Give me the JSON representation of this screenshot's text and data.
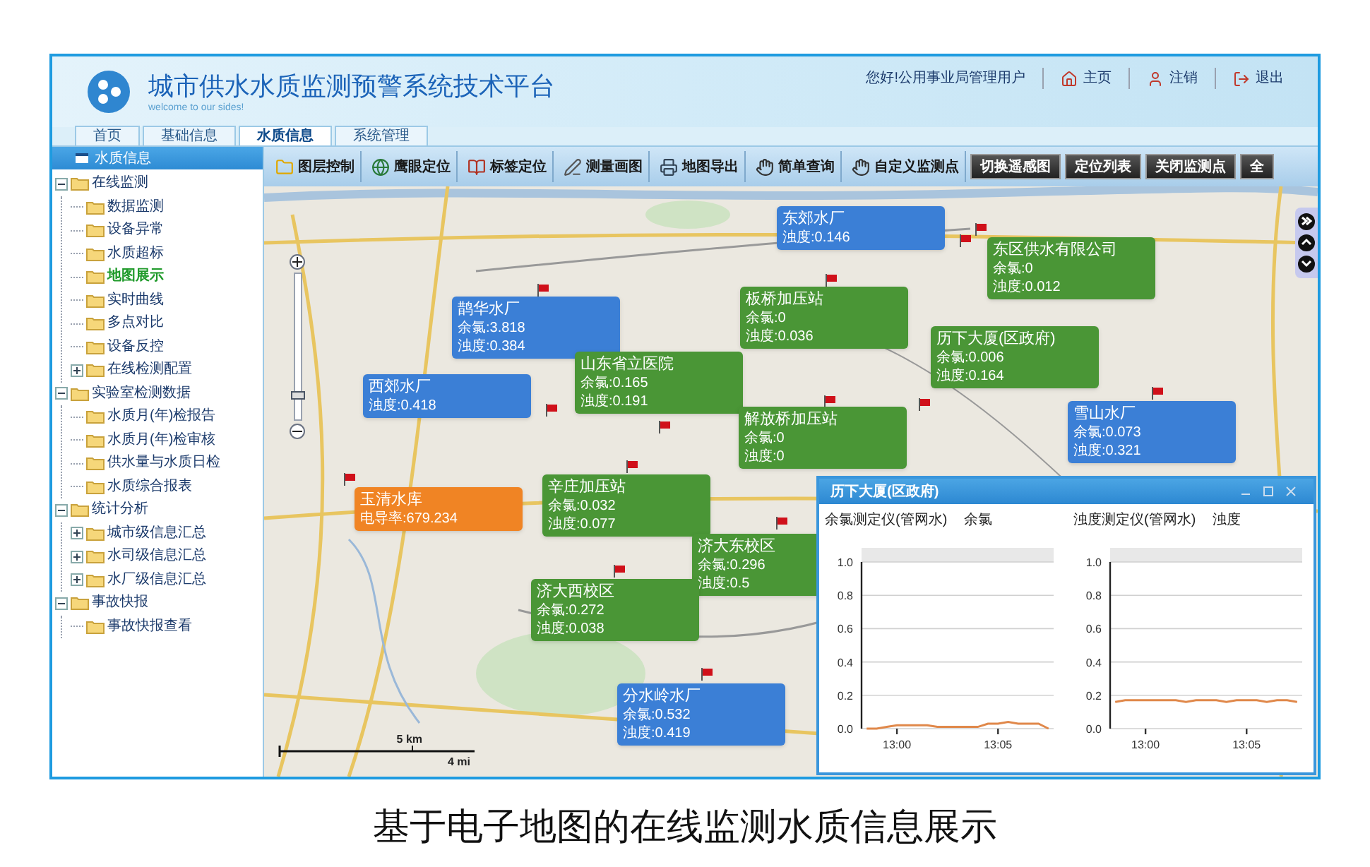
{
  "header": {
    "title": "城市供水水质监测预警系统技术平台",
    "subtitle": "welcome to our sides!",
    "greeting": "您好!公用事业局管理用户",
    "links": [
      {
        "kind": "home",
        "label": "主页"
      },
      {
        "kind": "user",
        "label": "注销"
      },
      {
        "kind": "exit",
        "label": "退出"
      }
    ]
  },
  "tabs": [
    {
      "label": "首页",
      "selected": false
    },
    {
      "label": "基础信息",
      "selected": false
    },
    {
      "label": "水质信息",
      "selected": true
    },
    {
      "label": "系统管理",
      "selected": false
    }
  ],
  "sidebar": {
    "title": "水质信息",
    "tree": [
      {
        "label": "在线监测",
        "kind": "group",
        "expanded": true,
        "selected": false,
        "children": [
          {
            "label": "数据监测",
            "kind": "leaf",
            "selected": false
          },
          {
            "label": "设备异常",
            "kind": "leaf",
            "selected": false
          },
          {
            "label": "水质超标",
            "kind": "leaf",
            "selected": false
          },
          {
            "label": "地图展示",
            "kind": "leaf",
            "selected": true
          },
          {
            "label": "实时曲线",
            "kind": "leaf",
            "selected": false
          },
          {
            "label": "多点对比",
            "kind": "leaf",
            "selected": false
          },
          {
            "label": "设备反控",
            "kind": "leaf",
            "selected": false
          },
          {
            "label": "在线检测配置",
            "kind": "group",
            "expanded": false,
            "selected": false
          }
        ]
      },
      {
        "label": "实验室检测数据",
        "kind": "group",
        "expanded": true,
        "selected": false,
        "children": [
          {
            "label": "水质月(年)检报告",
            "kind": "leaf",
            "selected": false
          },
          {
            "label": "水质月(年)检审核",
            "kind": "leaf",
            "selected": false
          },
          {
            "label": "供水量与水质日检",
            "kind": "leaf",
            "selected": false
          },
          {
            "label": "水质综合报表",
            "kind": "leaf",
            "selected": false
          }
        ]
      },
      {
        "label": "统计分析",
        "kind": "group",
        "expanded": true,
        "selected": false,
        "children": [
          {
            "label": "城市级信息汇总",
            "kind": "group",
            "expanded": false,
            "selected": false
          },
          {
            "label": "水司级信息汇总",
            "kind": "group",
            "expanded": false,
            "selected": false
          },
          {
            "label": "水厂级信息汇总",
            "kind": "group",
            "expanded": false,
            "selected": false
          }
        ]
      },
      {
        "label": "事故快报",
        "kind": "group",
        "expanded": true,
        "selected": false,
        "children": [
          {
            "label": "事故快报查看",
            "kind": "leaf",
            "selected": false
          }
        ]
      }
    ]
  },
  "toolbar": {
    "tools": [
      {
        "kind": "folder",
        "label": "图层控制"
      },
      {
        "kind": "globe",
        "label": "鹰眼定位"
      },
      {
        "kind": "book",
        "label": "标签定位"
      },
      {
        "kind": "pen",
        "label": "测量画图"
      },
      {
        "kind": "printer",
        "label": "地图导出"
      },
      {
        "kind": "hand",
        "label": "简单查询"
      },
      {
        "kind": "hand",
        "label": "自定义监测点"
      }
    ],
    "buttons": [
      "切换遥感图",
      "定位列表",
      "关闭监测点",
      "全"
    ]
  },
  "map": {
    "zoom": {
      "level": 0.17
    },
    "markers": [
      {
        "name": "东郊水厂",
        "color": "#3b7fd6",
        "readings": [
          "浊度:0.146"
        ]
      },
      {
        "name": "鹊华水厂",
        "color": "#3b7fd6",
        "readings": [
          "余氯:3.818",
          "浊度:0.384"
        ]
      },
      {
        "name": "板桥加压站",
        "color": "#4a9636",
        "readings": [
          "余氯:0",
          "浊度:0.036"
        ]
      },
      {
        "name": "东区供水有限公司",
        "color": "#4a9636",
        "readings": [
          "余氯:0",
          "浊度:0.012"
        ]
      },
      {
        "name": "山东省立医院",
        "color": "#4a9636",
        "readings": [
          "余氯:0.165",
          "浊度:0.191"
        ]
      },
      {
        "name": "历下大厦(区政府)",
        "color": "#4a9636",
        "readings": [
          "余氯:0.006",
          "浊度:0.164"
        ]
      },
      {
        "name": "西郊水厂",
        "color": "#3b7fd6",
        "readings": [
          "浊度:0.418"
        ]
      },
      {
        "name": "解放桥加压站",
        "color": "#4a9636",
        "readings": [
          "余氯:0",
          "浊度:0"
        ]
      },
      {
        "name": "雪山水厂",
        "color": "#3b7fd6",
        "readings": [
          "余氯:0.073",
          "浊度:0.321"
        ]
      },
      {
        "name": "玉清水库",
        "color": "#f08424",
        "readings": [
          "电导率:679.234"
        ]
      },
      {
        "name": "辛庄加压站",
        "color": "#4a9636",
        "readings": [
          "余氯:0.032",
          "浊度:0.077"
        ]
      },
      {
        "name": "济大东校区",
        "color": "#4a9636",
        "readings": [
          "余氯:0.296",
          "浊度:0.5"
        ]
      },
      {
        "name": "济大西校区",
        "color": "#4a9636",
        "readings": [
          "余氯:0.272",
          "浊度:0.038"
        ]
      },
      {
        "name": "分水岭水厂",
        "color": "#3b7fd6",
        "readings": [
          "余氯:0.532",
          "浊度:0.419"
        ]
      }
    ],
    "scale_bar": {
      "metric": "5 km",
      "imperial": "4 mi"
    }
  },
  "popup": {
    "title": "历下大厦(区政府)",
    "charts": [
      {
        "instrument": "余氯测定仪(管网水)",
        "chart_data": {
          "type": "line",
          "title": "余氯",
          "grid": true,
          "categories": [
            null,
            null,
            null,
            "13:00",
            null,
            null,
            null,
            null,
            null,
            null,
            null,
            null,
            null,
            "13:05",
            null,
            null,
            null,
            null,
            null
          ],
          "values": [
            0,
            0,
            0.01,
            0.02,
            0.02,
            0.02,
            0.02,
            0.01,
            0.01,
            0.01,
            0.01,
            0.01,
            0.03,
            0.03,
            0.04,
            0.03,
            0.03,
            0.03,
            0
          ],
          "ylim": [
            0,
            1
          ],
          "yticks": [
            {
              "value": 0,
              "label": "0.0"
            },
            {
              "value": 0.2,
              "label": "0.2"
            },
            {
              "value": 0.4,
              "label": "0.4"
            },
            {
              "value": 0.6,
              "label": "0.6"
            },
            {
              "value": 0.8,
              "label": "0.8"
            },
            {
              "value": 1,
              "label": "1.0"
            }
          ]
        }
      },
      {
        "instrument": "浊度测定仪(管网水)",
        "chart_data": {
          "type": "line",
          "title": "浊度",
          "grid": true,
          "categories": [
            null,
            null,
            null,
            "13:00",
            null,
            null,
            null,
            null,
            null,
            null,
            null,
            null,
            null,
            "13:05",
            null,
            null,
            null,
            null,
            null
          ],
          "values": [
            0.16,
            0.17,
            0.17,
            0.17,
            0.17,
            0.17,
            0.17,
            0.16,
            0.17,
            0.17,
            0.17,
            0.16,
            0.17,
            0.17,
            0.17,
            0.16,
            0.17,
            0.17,
            0.16
          ],
          "ylim": [
            0,
            1
          ],
          "yticks": [
            {
              "value": 0,
              "label": "0.0"
            },
            {
              "value": 0.2,
              "label": "0.2"
            },
            {
              "value": 0.4,
              "label": "0.4"
            },
            {
              "value": 0.6,
              "label": "0.6"
            },
            {
              "value": 0.8,
              "label": "0.8"
            },
            {
              "value": 1,
              "label": "1.0"
            }
          ]
        }
      }
    ]
  },
  "caption": "基于电子地图的在线监测水质信息展示"
}
